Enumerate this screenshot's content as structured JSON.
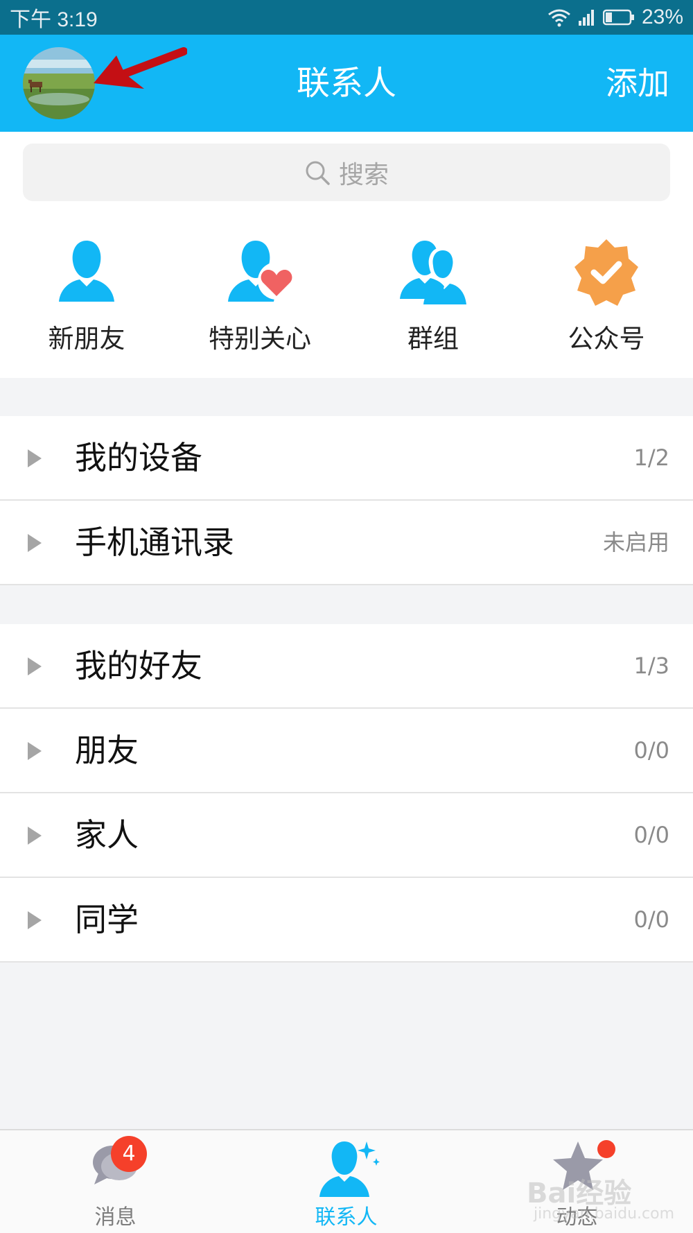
{
  "status_bar": {
    "time": "下午 3:19",
    "battery": "23%"
  },
  "header": {
    "title": "联系人",
    "add_label": "添加"
  },
  "search": {
    "placeholder": "搜索"
  },
  "quick_entries": [
    {
      "label": "新朋友",
      "icon": "person-icon"
    },
    {
      "label": "特别关心",
      "icon": "person-heart-icon"
    },
    {
      "label": "群组",
      "icon": "group-icon"
    },
    {
      "label": "公众号",
      "icon": "badge-check-icon"
    }
  ],
  "groups_section_1": [
    {
      "name": "我的设备",
      "count": "1/2"
    },
    {
      "name": "手机通讯录",
      "count": "未启用"
    }
  ],
  "groups_section_2": [
    {
      "name": "我的好友",
      "count": "1/3"
    },
    {
      "name": "朋友",
      "count": "0/0"
    },
    {
      "name": "家人",
      "count": "0/0"
    },
    {
      "name": "同学",
      "count": "0/0"
    }
  ],
  "tabbar": {
    "messages": {
      "label": "消息",
      "badge": "4"
    },
    "contacts": {
      "label": "联系人"
    },
    "moments": {
      "label": "动态"
    }
  },
  "watermark": {
    "text": "Bai经验",
    "sub": "jingyan.baidu.com"
  },
  "colors": {
    "header": "#12b7f5",
    "status_bar": "#0b6f8d",
    "badge": "#f5402a",
    "heart": "#f06262",
    "official": "#f5a04a"
  }
}
